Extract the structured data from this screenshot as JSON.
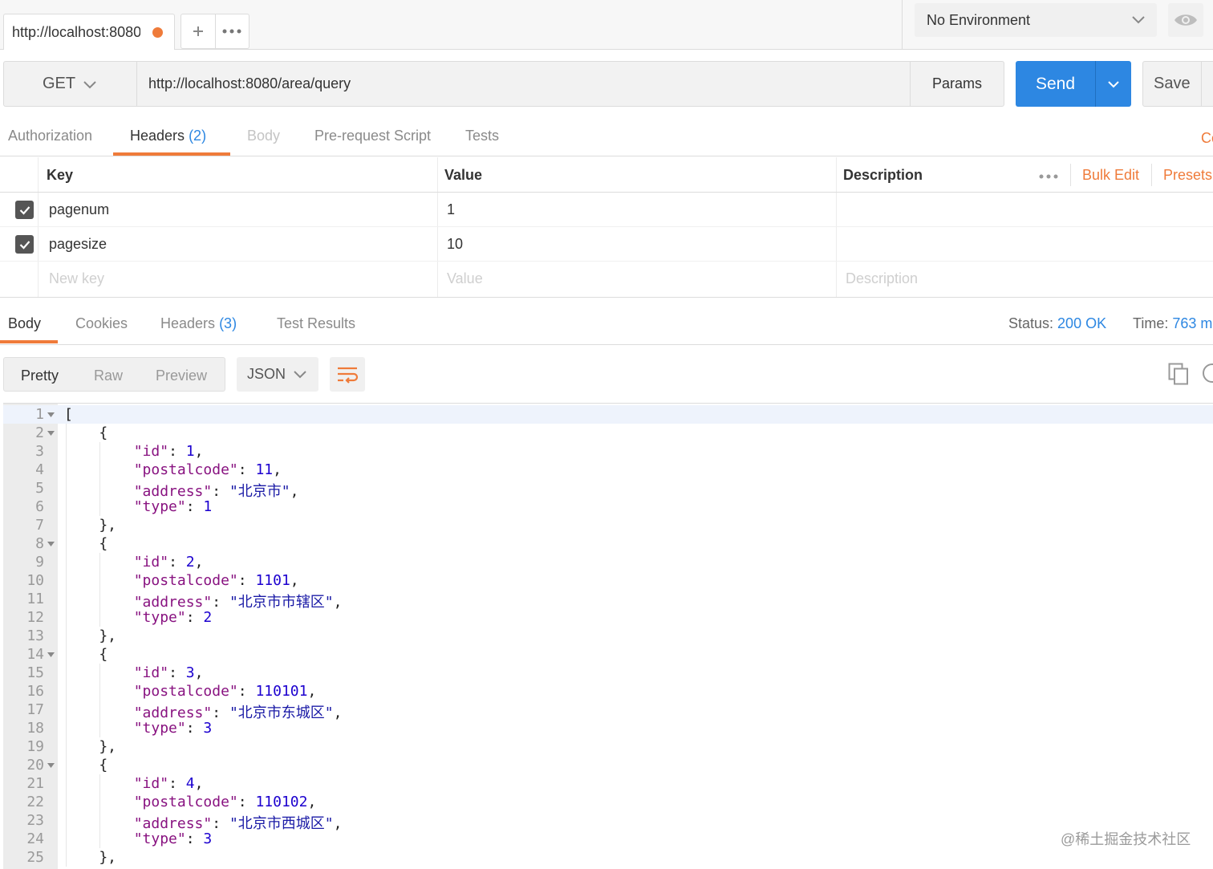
{
  "top_bar": {
    "request_tab_title": "http://localhost:8080",
    "new_tab_icon": "plus-icon",
    "more_icon": "ellipsis-icon",
    "environment": "No Environment",
    "eye_icon": "eye-icon"
  },
  "request": {
    "method": "GET",
    "url": "http://localhost:8080/area/query",
    "params_label": "Params",
    "send_label": "Send",
    "save_label": "Save"
  },
  "request_tabs": [
    {
      "label": "Authorization",
      "count": ""
    },
    {
      "label": "Headers",
      "count": "(2)"
    },
    {
      "label": "Body",
      "count": ""
    },
    {
      "label": "Pre-request Script",
      "count": ""
    },
    {
      "label": "Tests",
      "count": ""
    }
  ],
  "cookies_link": "Co",
  "headers_table": {
    "columns": [
      "Key",
      "Value",
      "Description"
    ],
    "bulk_edit": "Bulk Edit",
    "presets": "Presets",
    "rows": [
      {
        "key": "pagenum",
        "value": "1",
        "checked": true
      },
      {
        "key": "pagesize",
        "value": "10",
        "checked": true
      }
    ],
    "placeholders": {
      "key": "New key",
      "value": "Value",
      "description": "Description"
    }
  },
  "response_tabs": [
    {
      "label": "Body",
      "count": ""
    },
    {
      "label": "Cookies",
      "count": ""
    },
    {
      "label": "Headers",
      "count": "(3)"
    },
    {
      "label": "Test Results",
      "count": ""
    }
  ],
  "response_status": {
    "status_label": "Status:",
    "status_value": "200 OK",
    "time_label": "Time:",
    "time_value": "763 m"
  },
  "response_toolbar": {
    "views": [
      "Pretty",
      "Raw",
      "Preview"
    ],
    "active_view": "Pretty",
    "format": "JSON"
  },
  "code_lines": [
    "[",
    "    {",
    "        \"id\": 1,",
    "        \"postalcode\": 11,",
    "        \"address\": \"北京市\",",
    "        \"type\": 1",
    "    },",
    "    {",
    "        \"id\": 2,",
    "        \"postalcode\": 1101,",
    "        \"address\": \"北京市市辖区\",",
    "        \"type\": 2",
    "    },",
    "    {",
    "        \"id\": 3,",
    "        \"postalcode\": 110101,",
    "        \"address\": \"北京市东城区\",",
    "        \"type\": 3",
    "    },",
    "    {",
    "        \"id\": 4,",
    "        \"postalcode\": 110102,",
    "        \"address\": \"北京市西城区\",",
    "        \"type\": 3",
    "    },"
  ],
  "fold_lines": [
    1,
    2,
    8,
    14,
    20
  ],
  "watermark": "@稀土掘金技术社区",
  "colors": {
    "accent_orange": "#ef7b3a",
    "send_blue": "#2d87e2",
    "json_key": "#881280",
    "json_value": "#1c00cf"
  }
}
